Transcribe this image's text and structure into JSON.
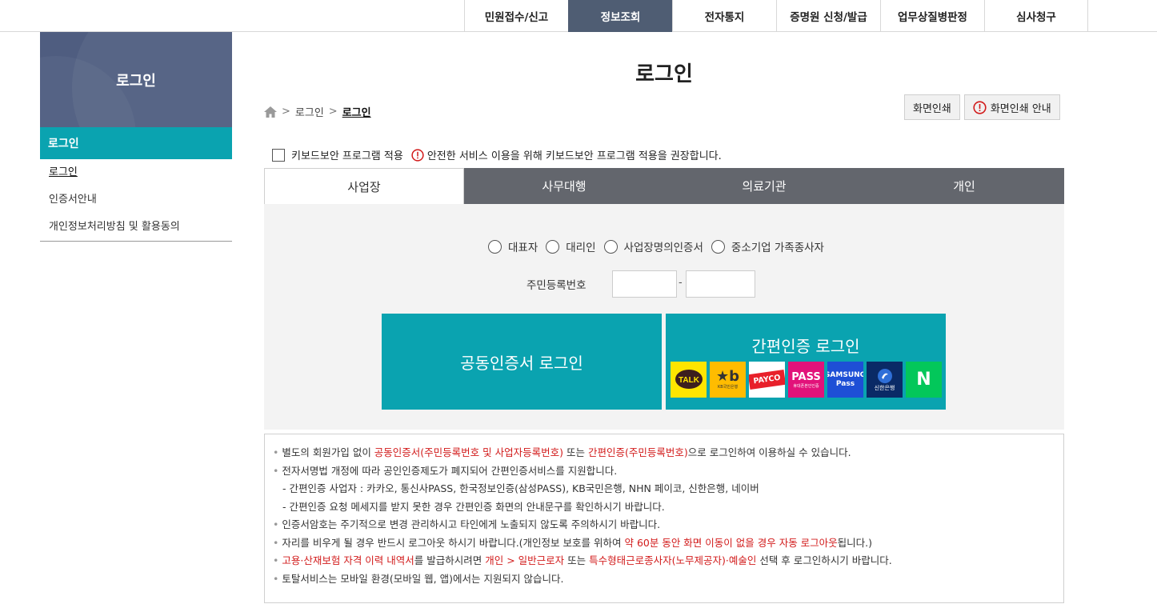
{
  "topnav": {
    "items": [
      "민원접수/신고",
      "정보조회",
      "전자통지",
      "증명원 신청/발급",
      "업무상질병판정",
      "심사청구"
    ]
  },
  "sidebar": {
    "title": "로그인",
    "selected": "로그인",
    "items": [
      "로그인",
      "인증서안내",
      "개인정보처리방침 및 활용동의"
    ]
  },
  "page": {
    "title": "로그인",
    "breadcrumb": [
      "로그인",
      "로그인"
    ],
    "print_button": "화면인쇄",
    "print_guide_button": "화면인쇄 안내"
  },
  "keyboard": {
    "label": "키보드보안 프로그램 적용",
    "notice": "안전한 서비스 이용을 위해 키보드보안 프로그램 적용을 권장합니다."
  },
  "tabs": [
    "사업장",
    "사무대행",
    "의료기관",
    "개인"
  ],
  "form": {
    "radios": [
      "대표자",
      "대리인",
      "사업장명의인증서",
      "중소기업 가족종사자"
    ],
    "rrn_label": "주민등록번호",
    "dash": "-",
    "cert_login": "공동인증서 로그인",
    "simple_login": "간편인증 로그인",
    "logos": [
      "TALK",
      "KB국민은행",
      "PAYCO",
      "PASS",
      "SAMSUNG Pass",
      "신한은행",
      "N"
    ]
  },
  "notices": {
    "l1": {
      "a": "별도의 회원가입 없이 ",
      "b": "공동인증서(주민등록번호 및 사업자등록번호)",
      "c": " 또는 ",
      "d": "간편인증(주민등록번호)",
      "e": "으로 로그인하여 이용하실 수 있습니다."
    },
    "l2": "전자서명법 개정에 따라 공인인증제도가 폐지되어 간편인증서비스를 지원합니다.",
    "l3": "- 간편인증 사업자 : 카카오, 통신사PASS, 한국정보인증(삼성PASS), KB국민은행, NHN 페이코, 신한은행, 네이버",
    "l4": "- 간편인증 요청 메세지를 받지 못한 경우 간편인증 화면의 안내문구를 확인하시기 바랍니다.",
    "l5": "인증서암호는 주기적으로 변경 관리하시고 타인에게 노출되지 않도록 주의하시기 바랍니다.",
    "l6": {
      "a": "자리를 비우게 될 경우 반드시 로그아웃 하시기 바랍니다.(개인정보 보호를 위하여 ",
      "b": "약 60분 동안 화면 이동이 없을 경우 자동 로그아웃",
      "c": "됩니다.)"
    },
    "l7": {
      "a": "고용·산재보험 자격 이력 내역서",
      "b": "를 발급하시려면 ",
      "c": "개인 > 일반근로자",
      "d": " 또는 ",
      "e": "특수형태근로종사자(노무제공자)·예술인",
      "f": " 선택 후 로그인하시기 바랍니다."
    },
    "l8": "토탈서비스는 모바일 환경(모바일 웹, 앱)에서는 지원되지 않습니다."
  },
  "colors": {
    "teal": "#0aa3b0",
    "nav_active": "#4f5d73",
    "tab_bar": "#63666d",
    "notice_red": "#d21b1b"
  }
}
